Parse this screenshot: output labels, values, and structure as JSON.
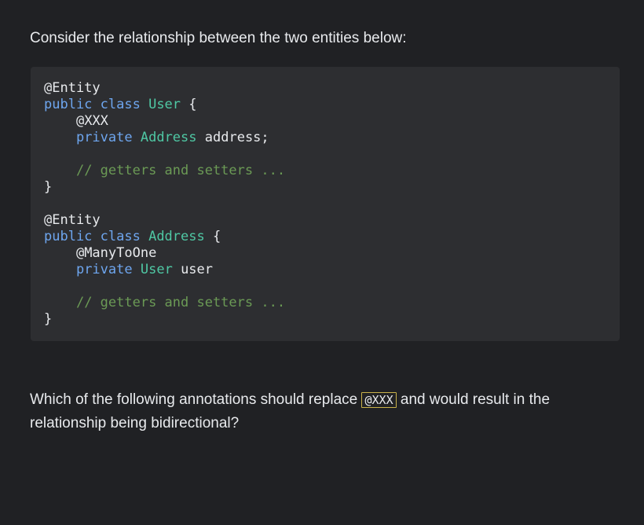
{
  "intro_text": "Consider the relationship between the two entities below:",
  "code": {
    "user_entity_annotation": "@Entity",
    "user_class_kw": "public class",
    "user_class_name": "User",
    "user_open_brace": "{",
    "user_field_annotation": "@XXX",
    "user_field_kw": "private",
    "user_field_type": "Address",
    "user_field_name": "address;",
    "user_comment": "// getters and setters ...",
    "user_close_brace": "}",
    "address_entity_annotation": "@Entity",
    "address_class_kw": "public class",
    "address_class_name": "Address",
    "address_open_brace": "{",
    "address_field_annotation": "@ManyToOne",
    "address_field_kw": "private",
    "address_field_type": "User",
    "address_field_name": "user",
    "address_comment": "// getters and setters ...",
    "address_close_brace": "}"
  },
  "question": {
    "before": "Which of the following annotations should replace ",
    "inline_code": "@XXX",
    "after": " and would result in the relationship being bidirectional?"
  },
  "colors": {
    "background": "#202124",
    "code_background": "#2d2e31",
    "keyword": "#6ea6ef",
    "type": "#4fc8a4",
    "comment": "#6b9a55",
    "highlight_border": "#c9b24a"
  }
}
